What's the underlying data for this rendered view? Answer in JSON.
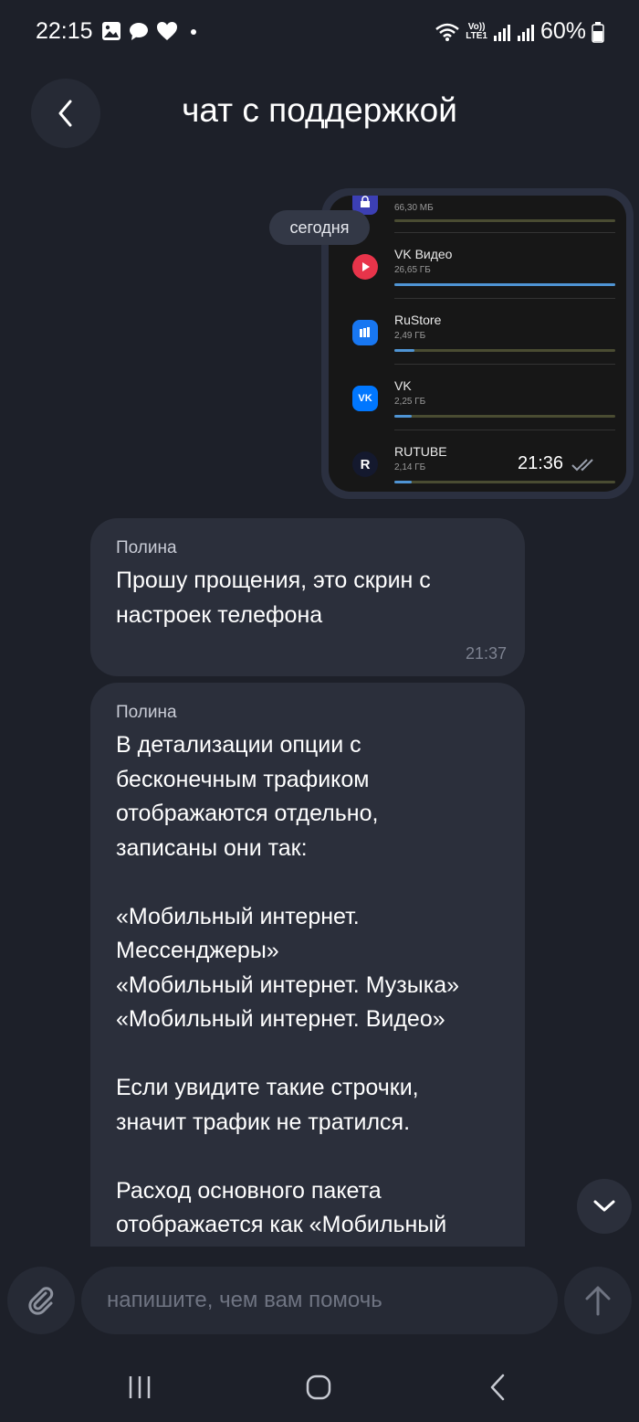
{
  "status_bar": {
    "time": "22:15",
    "battery": "60%",
    "lte_top": "Vo))",
    "lte_bottom": "LTE1",
    "icons": [
      "image-icon",
      "chat-icon",
      "heart-icon",
      "dot-icon",
      "wifi-icon",
      "signal-icon",
      "signal-icon",
      "battery-icon"
    ]
  },
  "header": {
    "title": "чат с поддержкой",
    "back_icon": "chevron-left-icon"
  },
  "date_pill": "сегодня",
  "screenshot": {
    "time": "21:36",
    "status_icon": "double-check-icon",
    "apps": [
      {
        "name": "",
        "size": "66,30 МБ",
        "usage": 0.0,
        "icon": "lock-app-icon",
        "color": "#3c3fb4"
      },
      {
        "name": "VK Видео",
        "size": "26,65 ГБ",
        "usage": 1.0,
        "icon": "vk-video-icon",
        "color": "#e8344a"
      },
      {
        "name": "RuStore",
        "size": "2,49 ГБ",
        "usage": 0.09,
        "icon": "rustore-icon",
        "color": "#1877f2"
      },
      {
        "name": "VK",
        "size": "2,25 ГБ",
        "usage": 0.08,
        "icon": "vk-icon",
        "color": "#0077ff"
      },
      {
        "name": "RUTUBE",
        "size": "2,14 ГБ",
        "usage": 0.08,
        "icon": "rutube-icon",
        "color": "#14192e"
      }
    ]
  },
  "messages": [
    {
      "author": "Полина",
      "text": "Прошу прощения, это скрин с\nнастроек телефона",
      "time": "21:37"
    },
    {
      "author": "Полина",
      "text": "В детализации опции с\nбесконечным трафиком\nотображаются отдельно,\nзаписаны они так:\n\n«Мобильный интернет.\nМессенджеры»\n«Мобильный интернет. Музыка»\n«Мобильный интернет. Видео»\n\nЕсли увидите такие строчки,\nзначит трафик не тратился.\n\nРасход основного пакета\nотображается как «Мобильный",
      "time": ""
    }
  ],
  "input": {
    "placeholder": "напишите, чем вам помочь"
  },
  "colors": {
    "background": "#1d2029",
    "bubble": "#2b2f3b",
    "accent_bar": "#4f94d4"
  }
}
